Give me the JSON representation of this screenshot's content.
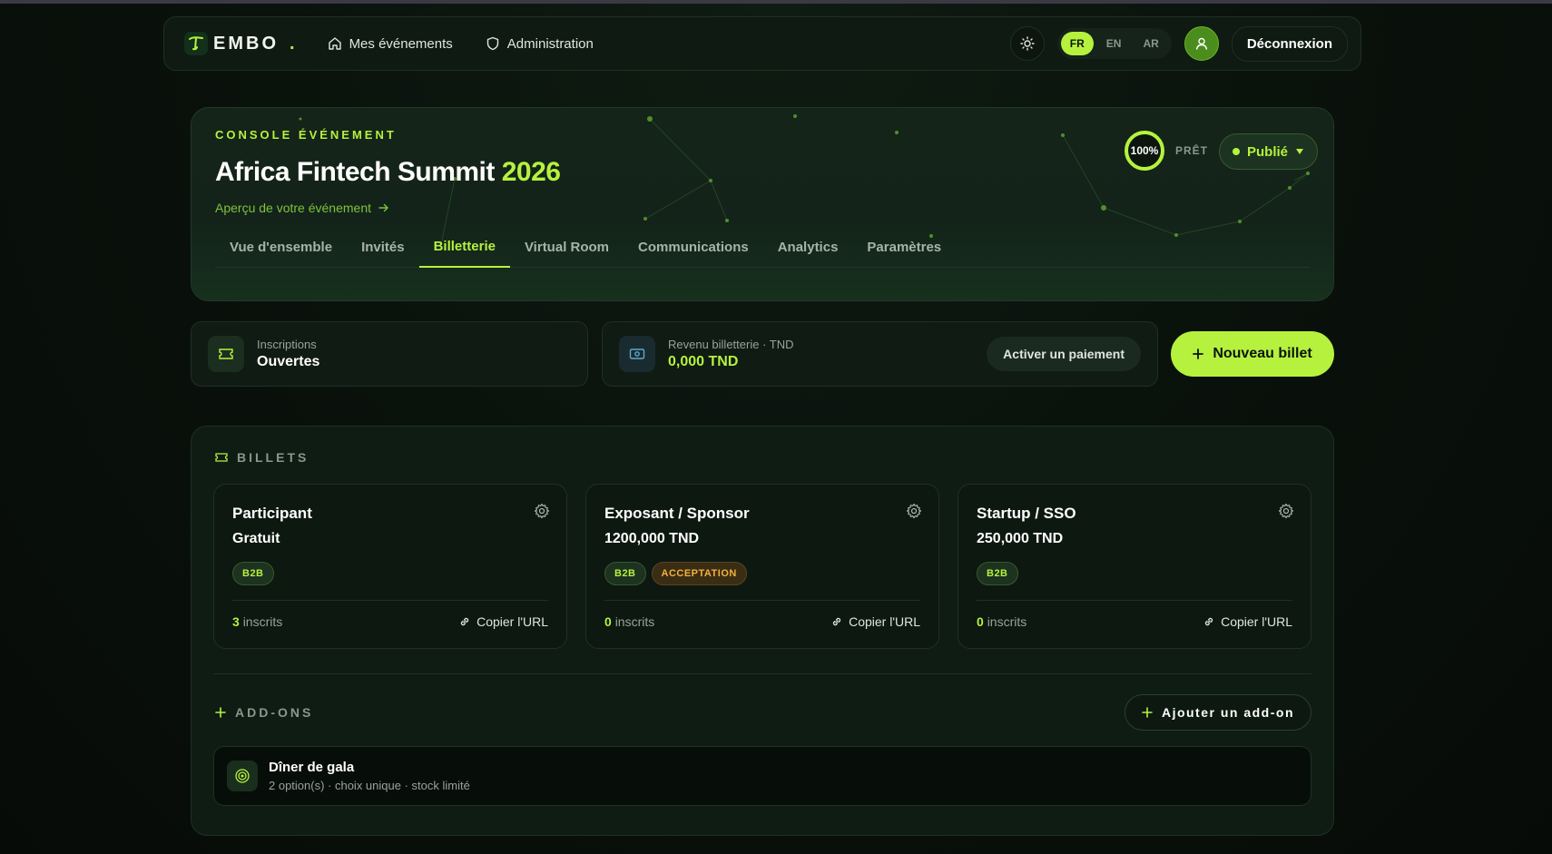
{
  "nav": {
    "logo_text": "EMBO",
    "logo_dot": ".",
    "links": [
      {
        "label": "Mes événements",
        "icon": "home-icon"
      },
      {
        "label": "Administration",
        "icon": "shield-icon"
      }
    ],
    "languages": [
      "FR",
      "EN",
      "AR"
    ],
    "active_language": "FR",
    "logout_label": "Déconnexion"
  },
  "hero": {
    "eyebrow": "CONSOLE ÉVÉNEMENT",
    "title": "Africa Fintech Summit",
    "year": "2026",
    "preview_link": "Aperçu de votre événement",
    "progress_label": "100%",
    "progress_value": 100,
    "ready_label": "PRÊT",
    "status_label": "Publié",
    "tabs": [
      "Vue d'ensemble",
      "Invités",
      "Billetterie",
      "Virtual Room",
      "Communications",
      "Analytics",
      "Paramètres"
    ],
    "active_tab": "Billetterie"
  },
  "stats": {
    "registrations": {
      "label": "Inscriptions",
      "value": "Ouvertes"
    },
    "revenue": {
      "label": "Revenu billetterie · TND",
      "value": "0,000 TND",
      "action": "Activer un paiement"
    },
    "new_ticket_label": "Nouveau billet"
  },
  "tickets": {
    "section_title": "BILLETS",
    "items": [
      {
        "name": "Participant",
        "price": "Gratuit",
        "badges": [
          "B2B"
        ],
        "count": "3",
        "count_label": "inscrits",
        "copy_label": "Copier l'URL"
      },
      {
        "name": "Exposant / Sponsor",
        "price": "1200,000 TND",
        "badges": [
          "B2B",
          "ACCEPTATION"
        ],
        "count": "0",
        "count_label": "inscrits",
        "copy_label": "Copier l'URL"
      },
      {
        "name": "Startup / SSO",
        "price": "250,000 TND",
        "badges": [
          "B2B"
        ],
        "count": "0",
        "count_label": "inscrits",
        "copy_label": "Copier l'URL"
      }
    ]
  },
  "addons": {
    "section_title": "ADD-ONS",
    "add_label": "Ajouter un add-on",
    "items": [
      {
        "title": "Dîner de gala",
        "subtitle": "2 option(s) · choix unique · stock limité"
      }
    ]
  },
  "colors": {
    "accent": "#b6f23d",
    "warning": "#f2b13d",
    "background": "#0a120c"
  }
}
